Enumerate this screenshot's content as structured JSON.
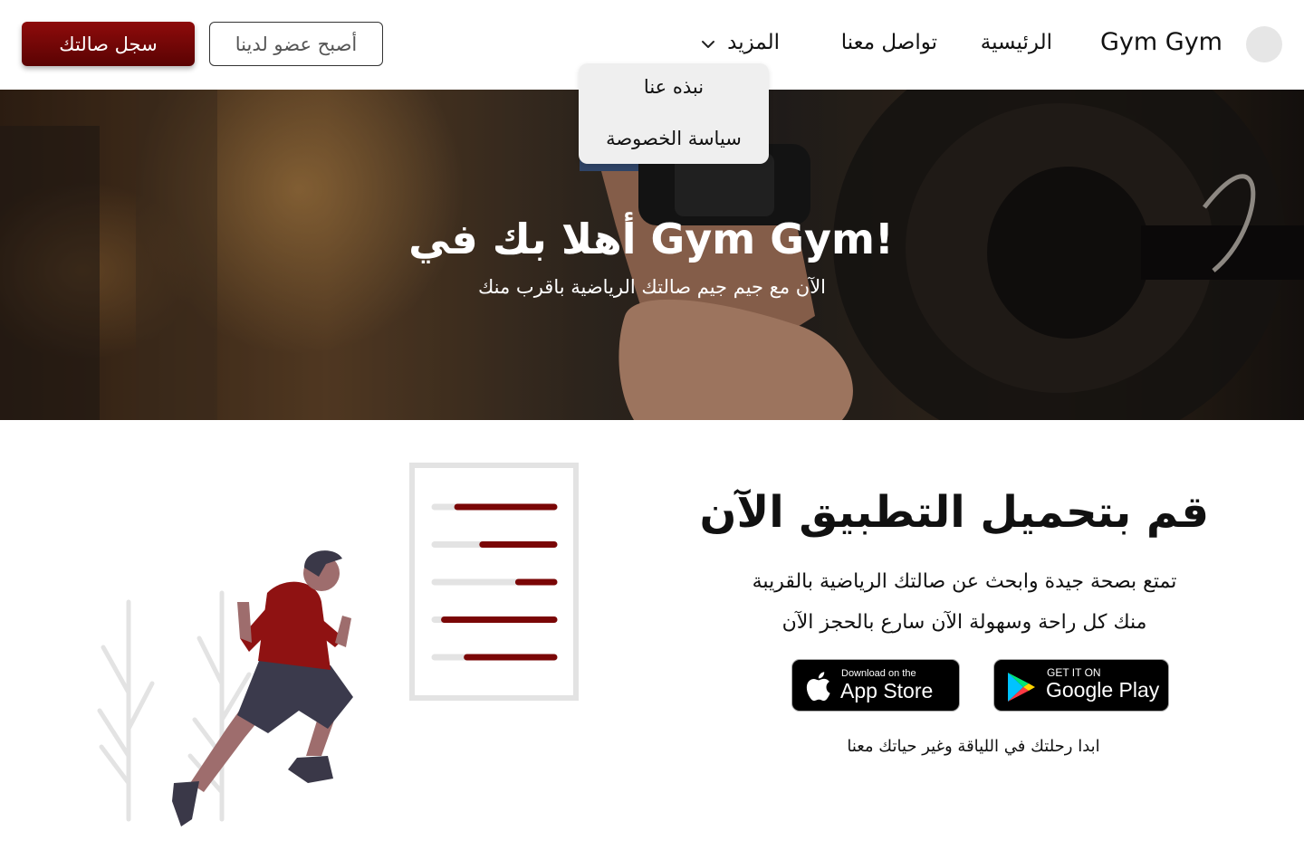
{
  "header": {
    "brand": "Gym Gym",
    "nav": {
      "home": "الرئيسية",
      "contact": "تواصل معنا",
      "more": "المزيد"
    },
    "dropdown": {
      "about": "نبذه عنا",
      "privacy": "سياسة الخصوصة"
    },
    "become_member": "أصبح عضو لدينا",
    "register_gym": "سجل صالتك"
  },
  "hero": {
    "title": "أهلا بك في Gym Gym!",
    "subtitle": "الآن مع جيم جيم صالتك الرياضية باقرب منك"
  },
  "download": {
    "title": "قم بتحميل التطبيق الآن",
    "line1": "تمتع بصحة جيدة وابحث عن صالتك الرياضية بالقريبة",
    "line2": "منك كل راحة وسهولة الآن سارع بالحجز الآن",
    "appstore_small": "Download on the",
    "appstore_big": "App Store",
    "googleplay_small": "GET IT ON",
    "googleplay_big": "Google Play",
    "tagline": "ابدا رحلتك في اللياقة وغير حياتك معنا"
  },
  "colors": {
    "accent": "#7a0606",
    "dropdown_bg": "#efefef"
  },
  "illustration": {
    "progress_fill": [
      0.81,
      0.6,
      0.3,
      0.92,
      0.73
    ]
  }
}
